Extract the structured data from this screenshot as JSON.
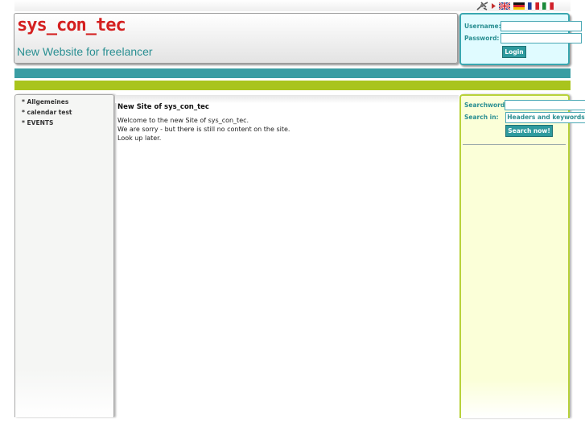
{
  "language_bar": {
    "icons": [
      "tools-icon",
      "arrow-right-icon"
    ],
    "flags": [
      "English",
      "Deutsch",
      "Français",
      "Italiano"
    ]
  },
  "header": {
    "site_title": "sys_con_tec",
    "subtitle": "New Website for freelancer"
  },
  "login": {
    "username_label": "Username:",
    "password_label": "Password:",
    "username_value": "",
    "password_value": "",
    "button_label": "Login"
  },
  "nav": {
    "items": [
      {
        "label": "* Allgemeines"
      },
      {
        "label": "* calendar test"
      },
      {
        "label": "* EVENTS"
      }
    ]
  },
  "main": {
    "title": "New Site of sys_con_tec",
    "lines": [
      "Welcome to the new Site of sys_con_tec.",
      "We are sorry - but there is still no content on the site.",
      "Look up later."
    ]
  },
  "search": {
    "searchword_label": "Searchword:",
    "searchword_value": "",
    "search_in_label": "Search in:",
    "search_in_selected": "Headers and keywords",
    "button_label": "Search now!"
  },
  "colors": {
    "title_red": "#d42020",
    "teal": "#3a9da3",
    "lime": "#a9c41d",
    "login_bg": "#e0fbff",
    "search_bg": "#fbffd8"
  }
}
